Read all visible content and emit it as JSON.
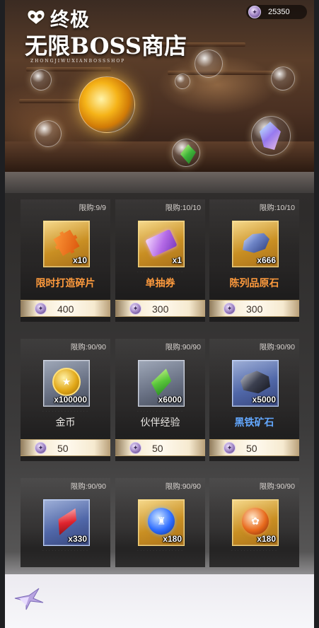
{
  "header": {
    "logo_text": "终极",
    "title": "无限BOSS商店",
    "subtitle": "ZHONGJIWUXIANBOSSSHOP",
    "currency_value": "25350"
  },
  "items": [
    {
      "limit": "限购:9/9",
      "qty": "x10",
      "name": "限时打造碎片",
      "price": "400",
      "icon": "puzzle-piece-icon",
      "name_color": "orange"
    },
    {
      "limit": "限购:10/10",
      "qty": "x1",
      "name": "单抽券",
      "price": "300",
      "icon": "ticket-icon",
      "name_color": "orange"
    },
    {
      "limit": "限购:10/10",
      "qty": "x666",
      "name": "陈列品原石",
      "price": "300",
      "icon": "ore-icon",
      "name_color": "orange"
    },
    {
      "limit": "限购:90/90",
      "qty": "x100000",
      "name": "金币",
      "price": "50",
      "icon": "gold-coin-icon",
      "name_color": "white"
    },
    {
      "limit": "限购:90/90",
      "qty": "x6000",
      "name": "伙伴经验",
      "price": "50",
      "icon": "green-crystal-icon",
      "name_color": "white"
    },
    {
      "limit": "限购:90/90",
      "qty": "x5000",
      "name": "黑铁矿石",
      "price": "50",
      "icon": "iron-ore-icon",
      "name_color": "blue"
    },
    {
      "limit": "限购:90/90",
      "qty": "x330",
      "name": "",
      "price": "",
      "icon": "red-shard-icon",
      "name_color": "blue"
    },
    {
      "limit": "限购:90/90",
      "qty": "x180",
      "name": "",
      "price": "",
      "icon": "blue-orb-icon",
      "name_color": "orange"
    },
    {
      "limit": "限购:90/90",
      "qty": "x180",
      "name": "",
      "price": "",
      "icon": "fire-orb-icon",
      "name_color": "orange"
    }
  ],
  "colors": {
    "accent_orange": "#ff9b3d",
    "accent_blue": "#63a8ff",
    "price_text": "#3a3028"
  }
}
